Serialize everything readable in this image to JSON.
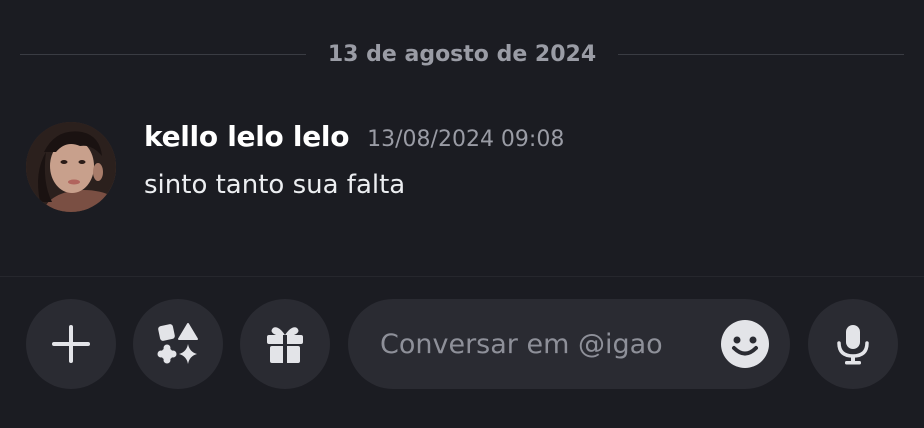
{
  "chat": {
    "date_divider": "13 de agosto de 2024",
    "messages": [
      {
        "author": "kello lelo lelo",
        "timestamp": "13/08/2024 09:08",
        "text": "sinto tanto sua falta"
      }
    ]
  },
  "composer": {
    "placeholder": "Conversar em @igao",
    "buttons": [
      {
        "icon": "plus-icon"
      },
      {
        "icon": "apps-icon"
      },
      {
        "icon": "gift-icon"
      },
      {
        "icon": "emoji-icon"
      },
      {
        "icon": "microphone-icon"
      }
    ]
  },
  "colors": {
    "background": "#1b1c22",
    "button_bg": "#2a2b32",
    "muted_text": "#9a9ca5",
    "icon": "#e3e4e8"
  }
}
